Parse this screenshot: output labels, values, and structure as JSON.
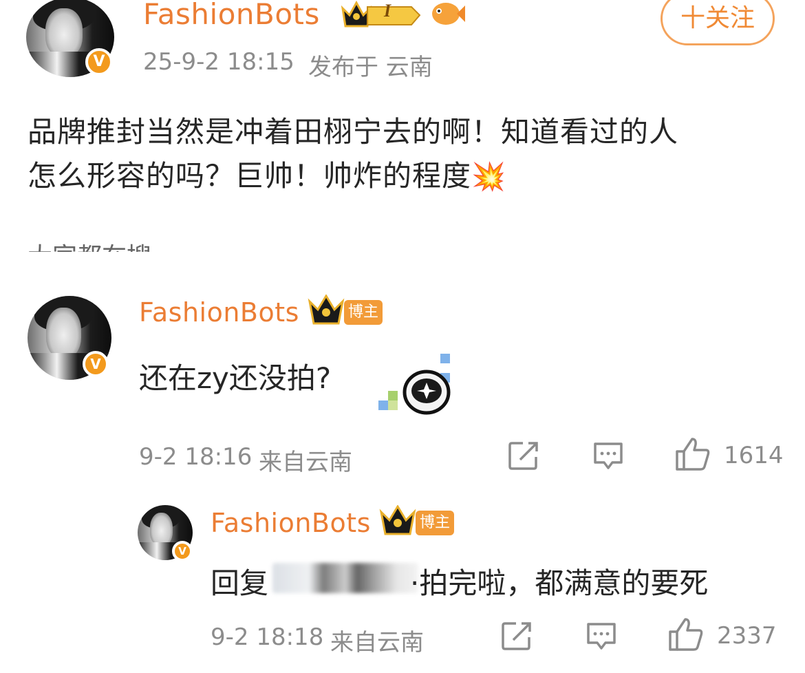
{
  "post": {
    "username": "FashionBots",
    "level_badge": "I",
    "timestamp": "25-9-2 18:15",
    "location": "发布于 云南",
    "follow_label": "十关注",
    "text_line1": "品牌推封当然是冲着田栩宁去的啊！知道看过的人",
    "text_line2": "怎么形容的吗？巨帅！帅炸的程度",
    "emoji": "💥",
    "partial_text": "大家都在搜",
    "verified_icon": "v-verified-icon",
    "colors": {
      "username": "#eb7d34",
      "badge": "#f39a1d",
      "meta": "#8c8c8c"
    }
  },
  "comments": [
    {
      "username": "FashionBots",
      "tag": "博主",
      "text": "还在zy还没拍?",
      "timestamp": "9-2 18:16",
      "location": "来自云南",
      "likes": "1614",
      "icons": [
        "share-icon",
        "comment-icon",
        "like-icon"
      ]
    },
    {
      "username": "FashionBots",
      "tag": "博主",
      "text_prefix": "回复",
      "text_suffix": "·拍完啦，都满意的要死",
      "timestamp": "9-2 18:18",
      "location": "来自云南",
      "likes": "2337",
      "icons": [
        "share-icon",
        "comment-icon",
        "like-icon"
      ]
    }
  ]
}
